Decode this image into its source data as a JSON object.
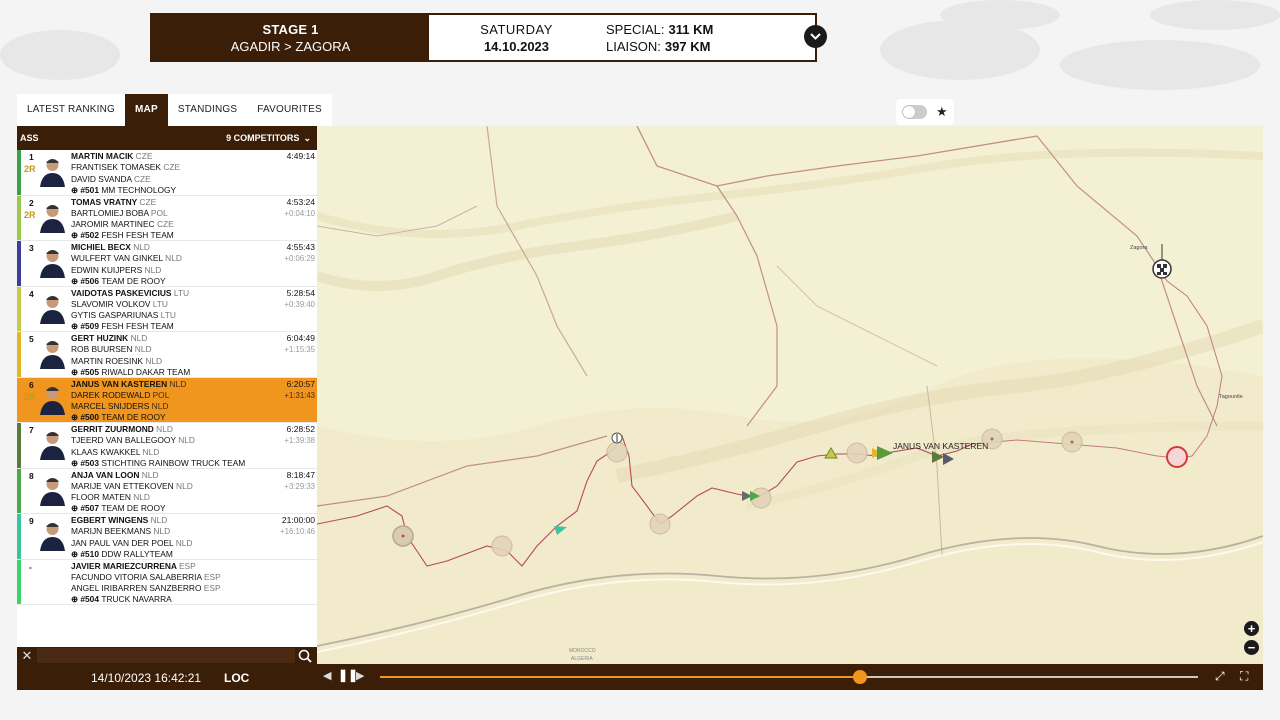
{
  "stage": {
    "name": "STAGE 1",
    "route": "AGADIR > ZAGORA",
    "day": "SATURDAY",
    "date": "14.10.2023",
    "special_label": "SPECIAL:",
    "special_value": "311 KM",
    "liaison_label": "LIAISON:",
    "liaison_value": "397 KM"
  },
  "tabs": [
    "LATEST RANKING",
    "MAP",
    "STANDINGS",
    "FAVOURITES"
  ],
  "active_tab": "MAP",
  "panel": {
    "category": "ASS",
    "competitors": "9 COMPETITORS"
  },
  "competitors": [
    {
      "pos": "1",
      "badge": "2R",
      "bar": "#3aa14a",
      "driver": "MARTIN MACIK",
      "dn": "CZE",
      "co1": "FRANTISEK TOMASEK",
      "c1n": "CZE",
      "co2": "DAVID SVANDA",
      "c2n": "CZE",
      "num": "#501",
      "team": "MM TECHNOLOGY",
      "time": "4:49:14",
      "gap": ""
    },
    {
      "pos": "2",
      "badge": "2R",
      "bar": "#9bc94a",
      "driver": "TOMAS VRATNY",
      "dn": "CZE",
      "co1": "BARTLOMIEJ BOBA",
      "c1n": "POL",
      "co2": "JAROMIR MARTINEC",
      "c2n": "CZE",
      "num": "#502",
      "team": "FESH FESH TEAM",
      "time": "4:53:24",
      "gap": "+0:04:10"
    },
    {
      "pos": "3",
      "badge": "",
      "bar": "#3a3f9a",
      "driver": "MICHIEL BECX",
      "dn": "NLD",
      "co1": "WULFERT VAN GINKEL",
      "c1n": "NLD",
      "co2": "EDWIN KUIJPERS",
      "c2n": "NLD",
      "num": "#506",
      "team": "TEAM DE ROOY",
      "time": "4:55:43",
      "gap": "+0:06:29"
    },
    {
      "pos": "4",
      "badge": "",
      "bar": "#c8c94a",
      "driver": "VAIDOTAS PASKEVICIUS",
      "dn": "LTU",
      "co1": "SLAVOMIR VOLKOV",
      "c1n": "LTU",
      "co2": "GYTIS GASPARIUNAS",
      "c2n": "LTU",
      "num": "#509",
      "team": "FESH FESH TEAM",
      "time": "5:28:54",
      "gap": "+0:39:40"
    },
    {
      "pos": "5",
      "badge": "",
      "bar": "#e2b624",
      "driver": "GERT HUZINK",
      "dn": "NLD",
      "co1": "ROB BUURSEN",
      "c1n": "NLD",
      "co2": "MARTIN ROESINK",
      "c2n": "NLD",
      "num": "#505",
      "team": "RIWALD DAKAR TEAM",
      "time": "6:04:49",
      "gap": "+1:15:35"
    },
    {
      "pos": "6",
      "badge": "2R",
      "bar": "#f0961f",
      "driver": "JANUS VAN KASTEREN",
      "dn": "NLD",
      "co1": "DAREK RODEWALD",
      "c1n": "POL",
      "co2": "MARCEL SNIJDERS",
      "c2n": "NLD",
      "num": "#500",
      "team": "TEAM DE ROOY",
      "time": "6:20:57",
      "gap": "+1:31:43",
      "highlight": true
    },
    {
      "pos": "7",
      "badge": "",
      "bar": "#5a7a3a",
      "driver": "GERRIT ZUURMOND",
      "dn": "NLD",
      "co1": "TJEERD VAN BALLEGOOY",
      "c1n": "NLD",
      "co2": "KLAAS KWAKKEL",
      "c2n": "NLD",
      "num": "#503",
      "team": "STICHTING RAINBOW TRUCK TEAM",
      "time": "6:28:52",
      "gap": "+1:39:38"
    },
    {
      "pos": "8",
      "badge": "",
      "bar": "#4aa84a",
      "driver": "ANJA VAN LOON",
      "dn": "NLD",
      "co1": "MARIJE VAN ETTEKOVEN",
      "c1n": "NLD",
      "co2": "FLOOR MATEN",
      "c2n": "NLD",
      "num": "#507",
      "team": "TEAM DE ROOY",
      "time": "8:18:47",
      "gap": "+3:29:33"
    },
    {
      "pos": "9",
      "badge": "",
      "bar": "#3ac49a",
      "driver": "EGBERT WINGENS",
      "dn": "NLD",
      "co1": "MARIJN BEEKMANS",
      "c1n": "NLD",
      "co2": "JAN PAUL VAN DER POEL",
      "c2n": "NLD",
      "num": "#510",
      "team": "DDW RALLYTEAM",
      "time": "21:00:00",
      "gap": "+16:10:46"
    },
    {
      "pos": "-",
      "badge": "",
      "bar": "#3ad46a",
      "driver": "JAVIER MARIEZCURRENA",
      "dn": "ESP",
      "co1": "FACUNDO VITORIA SALABERRIA",
      "c1n": "ESP",
      "co2": "ANGEL IRIBARREN SANZBERRO",
      "c2n": "ESP",
      "num": "#504",
      "team": "TRUCK NAVARRA",
      "time": "",
      "gap": ""
    }
  ],
  "map": {
    "town_zagora": "Zagora",
    "town_tagounite": "Tagounite",
    "vehicle_label": "JANUS VAN KASTEREN",
    "border_labels": [
      "MOROCCO",
      "ALGERIA"
    ]
  },
  "playback": {
    "datetime": "14/10/2023 16:42:21",
    "mode": "LOC",
    "progress": 0.587
  }
}
